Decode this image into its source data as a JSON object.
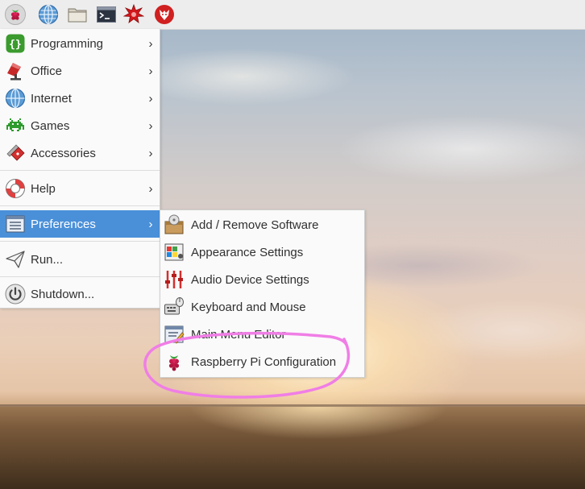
{
  "taskbar": {
    "buttons": [
      {
        "icon": "raspberry-icon"
      },
      {
        "icon": "web-browser-icon"
      },
      {
        "icon": "file-manager-icon"
      },
      {
        "icon": "terminal-icon"
      },
      {
        "icon": "mathematica-icon"
      },
      {
        "icon": "wolfram-icon"
      }
    ]
  },
  "main_menu": {
    "items": [
      {
        "label": "Programming",
        "icon": "programming-icon",
        "arrow": "›"
      },
      {
        "label": "Office",
        "icon": "office-icon",
        "arrow": "›"
      },
      {
        "label": "Internet",
        "icon": "internet-globe-icon",
        "arrow": "›"
      },
      {
        "label": "Games",
        "icon": "games-invader-icon",
        "arrow": "›"
      },
      {
        "label": "Accessories",
        "icon": "accessories-knife-icon",
        "arrow": "›"
      },
      {
        "label": "Help",
        "icon": "help-lifebuoy-icon",
        "arrow": "›"
      },
      {
        "label": "Preferences",
        "icon": "preferences-icon",
        "arrow": "›"
      },
      {
        "label": "Run...",
        "icon": "run-paperplane-icon"
      },
      {
        "label": "Shutdown...",
        "icon": "shutdown-power-icon"
      }
    ]
  },
  "preferences_submenu": {
    "items": [
      {
        "label": "Add / Remove Software",
        "icon": "package-icon"
      },
      {
        "label": "Appearance Settings",
        "icon": "appearance-icon"
      },
      {
        "label": "Audio Device Settings",
        "icon": "audio-mixer-icon"
      },
      {
        "label": "Keyboard and Mouse",
        "icon": "keyboard-mouse-icon"
      },
      {
        "label": "Main Menu Editor",
        "icon": "menu-editor-icon"
      },
      {
        "label": "Raspberry Pi Configuration",
        "icon": "raspberry-config-icon"
      }
    ]
  },
  "colors": {
    "menu_highlight": "#4a90d9",
    "annotation": "#f07ee6"
  }
}
